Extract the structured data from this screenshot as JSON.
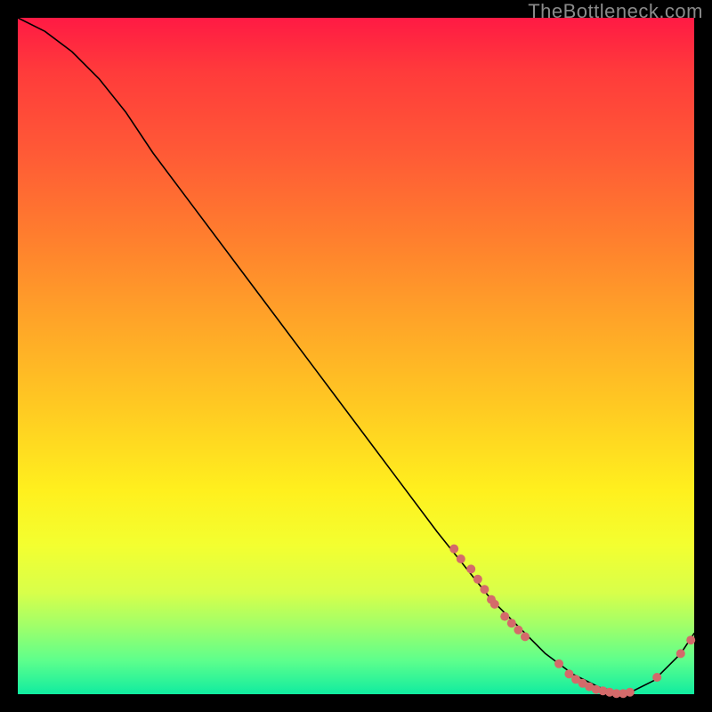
{
  "watermark": "TheBottleneck.com",
  "chart_data": {
    "type": "line",
    "title": "",
    "xlabel": "",
    "ylabel": "",
    "xlim": [
      0,
      100
    ],
    "ylim": [
      0,
      100
    ],
    "curve": {
      "x": [
        0,
        4,
        8,
        12,
        16,
        20,
        26,
        32,
        38,
        44,
        50,
        56,
        62,
        66,
        70,
        74,
        78,
        82,
        86,
        90,
        94,
        98,
        100
      ],
      "y": [
        100,
        98,
        95,
        91,
        86,
        80,
        72,
        64,
        56,
        48,
        40,
        32,
        24,
        19,
        14,
        10,
        6,
        3,
        1,
        0,
        2,
        6,
        9
      ]
    },
    "markers": [
      {
        "x": 64.5,
        "y": 21.5
      },
      {
        "x": 65.5,
        "y": 20.0
      },
      {
        "x": 67.0,
        "y": 18.5
      },
      {
        "x": 68.0,
        "y": 17.0
      },
      {
        "x": 69.0,
        "y": 15.5
      },
      {
        "x": 70.0,
        "y": 14.0
      },
      {
        "x": 70.5,
        "y": 13.3
      },
      {
        "x": 72.0,
        "y": 11.5
      },
      {
        "x": 73.0,
        "y": 10.5
      },
      {
        "x": 74.0,
        "y": 9.5
      },
      {
        "x": 75.0,
        "y": 8.5
      },
      {
        "x": 80.0,
        "y": 4.5
      },
      {
        "x": 81.5,
        "y": 3.0
      },
      {
        "x": 82.5,
        "y": 2.2
      },
      {
        "x": 83.5,
        "y": 1.6
      },
      {
        "x": 84.5,
        "y": 1.1
      },
      {
        "x": 85.5,
        "y": 0.7
      },
      {
        "x": 86.5,
        "y": 0.5
      },
      {
        "x": 87.5,
        "y": 0.3
      },
      {
        "x": 88.5,
        "y": 0.1
      },
      {
        "x": 89.5,
        "y": 0.1
      },
      {
        "x": 90.5,
        "y": 0.3
      },
      {
        "x": 94.5,
        "y": 2.5
      },
      {
        "x": 98.0,
        "y": 6.0
      },
      {
        "x": 99.5,
        "y": 8.0
      }
    ],
    "marker_radius_px": 5
  }
}
